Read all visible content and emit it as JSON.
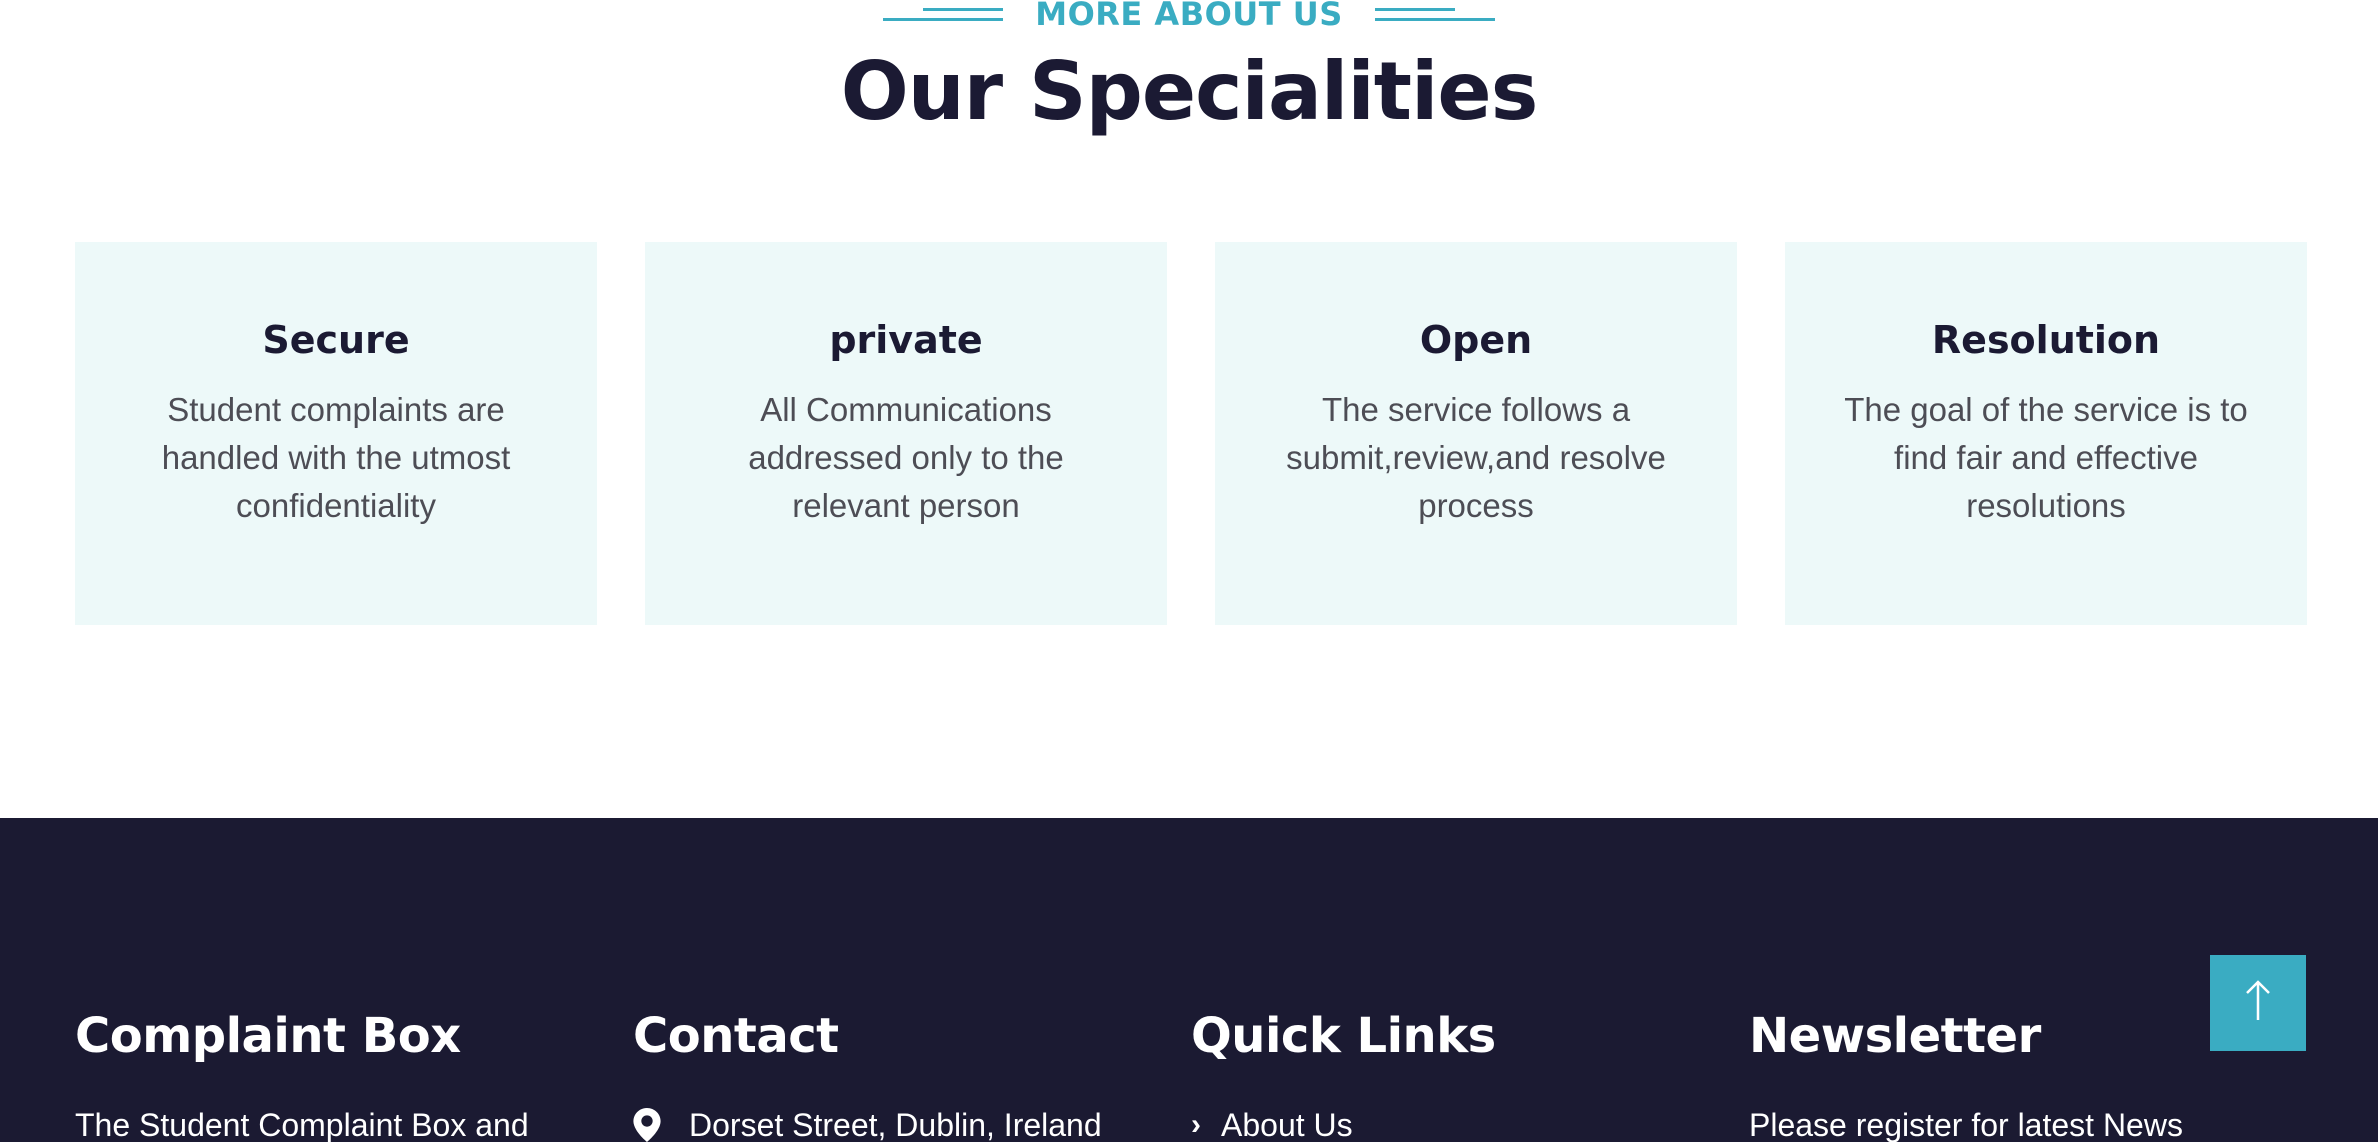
{
  "specialities": {
    "eyebrow": "MORE ABOUT US",
    "title": "Our Specialities",
    "cards": [
      {
        "title": "Secure",
        "text": "Student complaints are handled with the utmost confidentiality"
      },
      {
        "title": "private",
        "text": "All Communications addressed only to the relevant person"
      },
      {
        "title": "Open",
        "text": "The service follows a submit,review,and resolve process"
      },
      {
        "title": "Resolution",
        "text": "The goal of the service is to find fair and effective resolutions"
      }
    ]
  },
  "footer": {
    "complaint_box": {
      "title": "Complaint Box",
      "text": "The Student Complaint Box and"
    },
    "contact": {
      "title": "Contact",
      "address": "Dorset Street, Dublin, Ireland",
      "icon": "map-pin-icon"
    },
    "quick_links": {
      "title": "Quick Links",
      "first_link": "About Us",
      "icon": "chevron-right-icon"
    },
    "newsletter": {
      "title": "Newsletter",
      "text": "Please register for latest News"
    }
  },
  "back_to_top": {
    "icon": "arrow-up-icon"
  },
  "colors": {
    "accent": "#3aacc2",
    "dark": "#1b1a33",
    "card_bg": "#edf9f9",
    "footer_bg": "#1b1a32"
  }
}
